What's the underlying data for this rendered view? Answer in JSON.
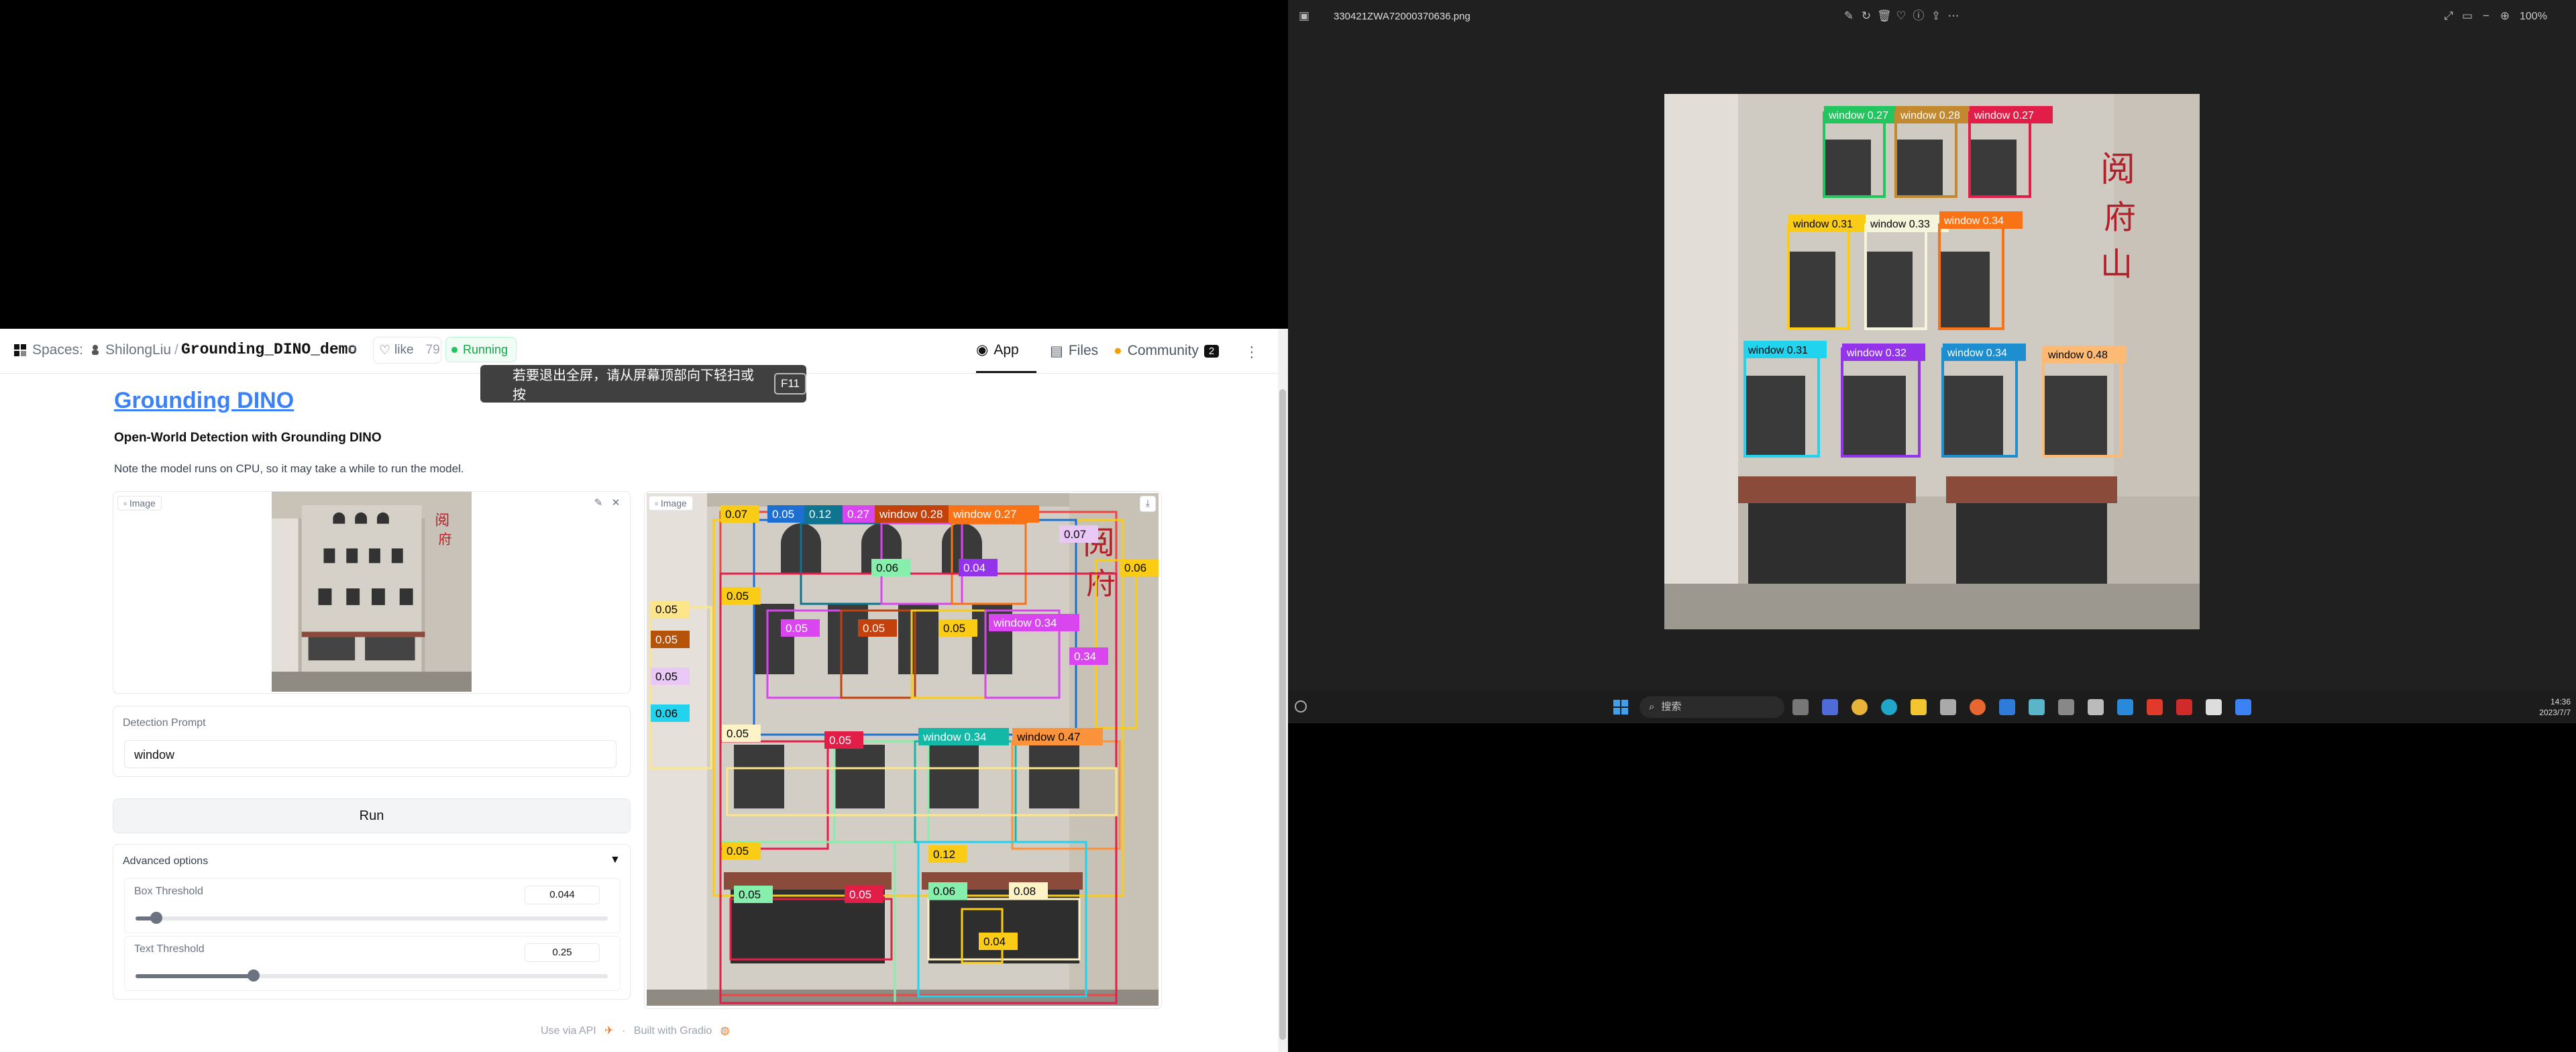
{
  "hf_header": {
    "spaces_label": "Spaces:",
    "owner": "ShilongLiu",
    "separator": "/",
    "space_name": "Grounding_DINO_demo",
    "like_label": "like",
    "like_count": "79",
    "status": "Running",
    "tabs": [
      {
        "label": "App",
        "icon": "app-icon"
      },
      {
        "label": "Files",
        "icon": "files-icon"
      },
      {
        "label": "Community",
        "icon": "community-icon",
        "count": "2"
      }
    ]
  },
  "fullscreen_toast": {
    "text": "若要退出全屏，请从屏幕顶部向下轻扫或按",
    "key": "F11"
  },
  "app": {
    "title": "Grounding DINO",
    "subtitle": "Open-World Detection with Grounding DINO",
    "note": "Note the model runs on CPU, so it may take a while to run the model.",
    "input_image_label": "Image",
    "output_image_label": "Image",
    "prompt_label": "Detection Prompt",
    "prompt_value": "window",
    "run_label": "Run",
    "advanced_label": "Advanced options",
    "advanced_arrow": "▼",
    "box_threshold": {
      "label": "Box Threshold",
      "value": "0.044",
      "fraction": 0.044
    },
    "text_threshold": {
      "label": "Text Threshold",
      "value": "0.25",
      "fraction": 0.25
    }
  },
  "footer": {
    "api_label": "Use via API",
    "separator": "·",
    "built_label": "Built with Gradio"
  },
  "output_detections": [
    {
      "label": "0.07",
      "color": "#facc15"
    },
    {
      "label": "0.05",
      "color": "#1d6fd1"
    },
    {
      "label": "0.12",
      "color": "#0e7490"
    },
    {
      "label": "0.27",
      "color": "#d946ef"
    },
    {
      "label": "window 0.28",
      "color": "#c2410c"
    },
    {
      "label": "window 0.27",
      "color": "#f97316"
    },
    {
      "label": "0.07",
      "color": "#e9c8f5"
    },
    {
      "label": "0.06",
      "color": "#86efac"
    },
    {
      "label": "0.04",
      "color": "#9333ea"
    },
    {
      "label": "0.06",
      "color": "#facc15"
    },
    {
      "label": "0.05",
      "color": "#fde68a"
    },
    {
      "label": "0.05",
      "color": "#b45309"
    },
    {
      "label": "0.05",
      "color": "#e9c8f5"
    },
    {
      "label": "0.06",
      "color": "#22d3ee"
    },
    {
      "label": "0.05",
      "color": "#facc15"
    },
    {
      "label": "0.05",
      "color": "#d946ef"
    },
    {
      "label": "0.05",
      "color": "#c2410c"
    },
    {
      "label": "0.05",
      "color": "#facc15"
    },
    {
      "label": "window 0.34",
      "color": "#d946ef"
    },
    {
      "label": "0.34",
      "color": "#d946ef"
    },
    {
      "label": "0.05",
      "color": "#fef3c7"
    },
    {
      "label": "0.05",
      "color": "#e11d48"
    },
    {
      "label": "window 0.34",
      "color": "#14b8a6"
    },
    {
      "label": "window 0.47",
      "color": "#fb923c"
    },
    {
      "label": "0.05",
      "color": "#facc15"
    },
    {
      "label": "0.12",
      "color": "#facc15"
    },
    {
      "label": "0.05",
      "color": "#86efac"
    },
    {
      "label": "0.05",
      "color": "#e11d48"
    },
    {
      "label": "0.06",
      "color": "#86efac"
    },
    {
      "label": "0.08",
      "color": "#fef3c7"
    },
    {
      "label": "0.04",
      "color": "#facc15"
    }
  ],
  "viewer": {
    "filename": "330421ZWA72000370636.png",
    "zoom": "100%",
    "detections": [
      {
        "label": "window 0.27",
        "color": "#22c55e"
      },
      {
        "label": "window 0.28",
        "color": "#c2892f"
      },
      {
        "label": "window 0.27",
        "color": "#e11d48"
      },
      {
        "label": "window 0.31",
        "color": "#facc15"
      },
      {
        "label": "window 0.33",
        "color": "#f5f5dc"
      },
      {
        "label": "window 0.34",
        "color": "#f97316"
      },
      {
        "label": "window 0.31",
        "color": "#22d3ee"
      },
      {
        "label": "window 0.32",
        "color": "#9333ea"
      },
      {
        "label": "window 0.34",
        "color": "#1d8fd1"
      },
      {
        "label": "window 0.48",
        "color": "#fdba74"
      }
    ]
  },
  "taskbar": {
    "search_label": "搜索",
    "time": "14:36",
    "date": "2023/7/7"
  }
}
